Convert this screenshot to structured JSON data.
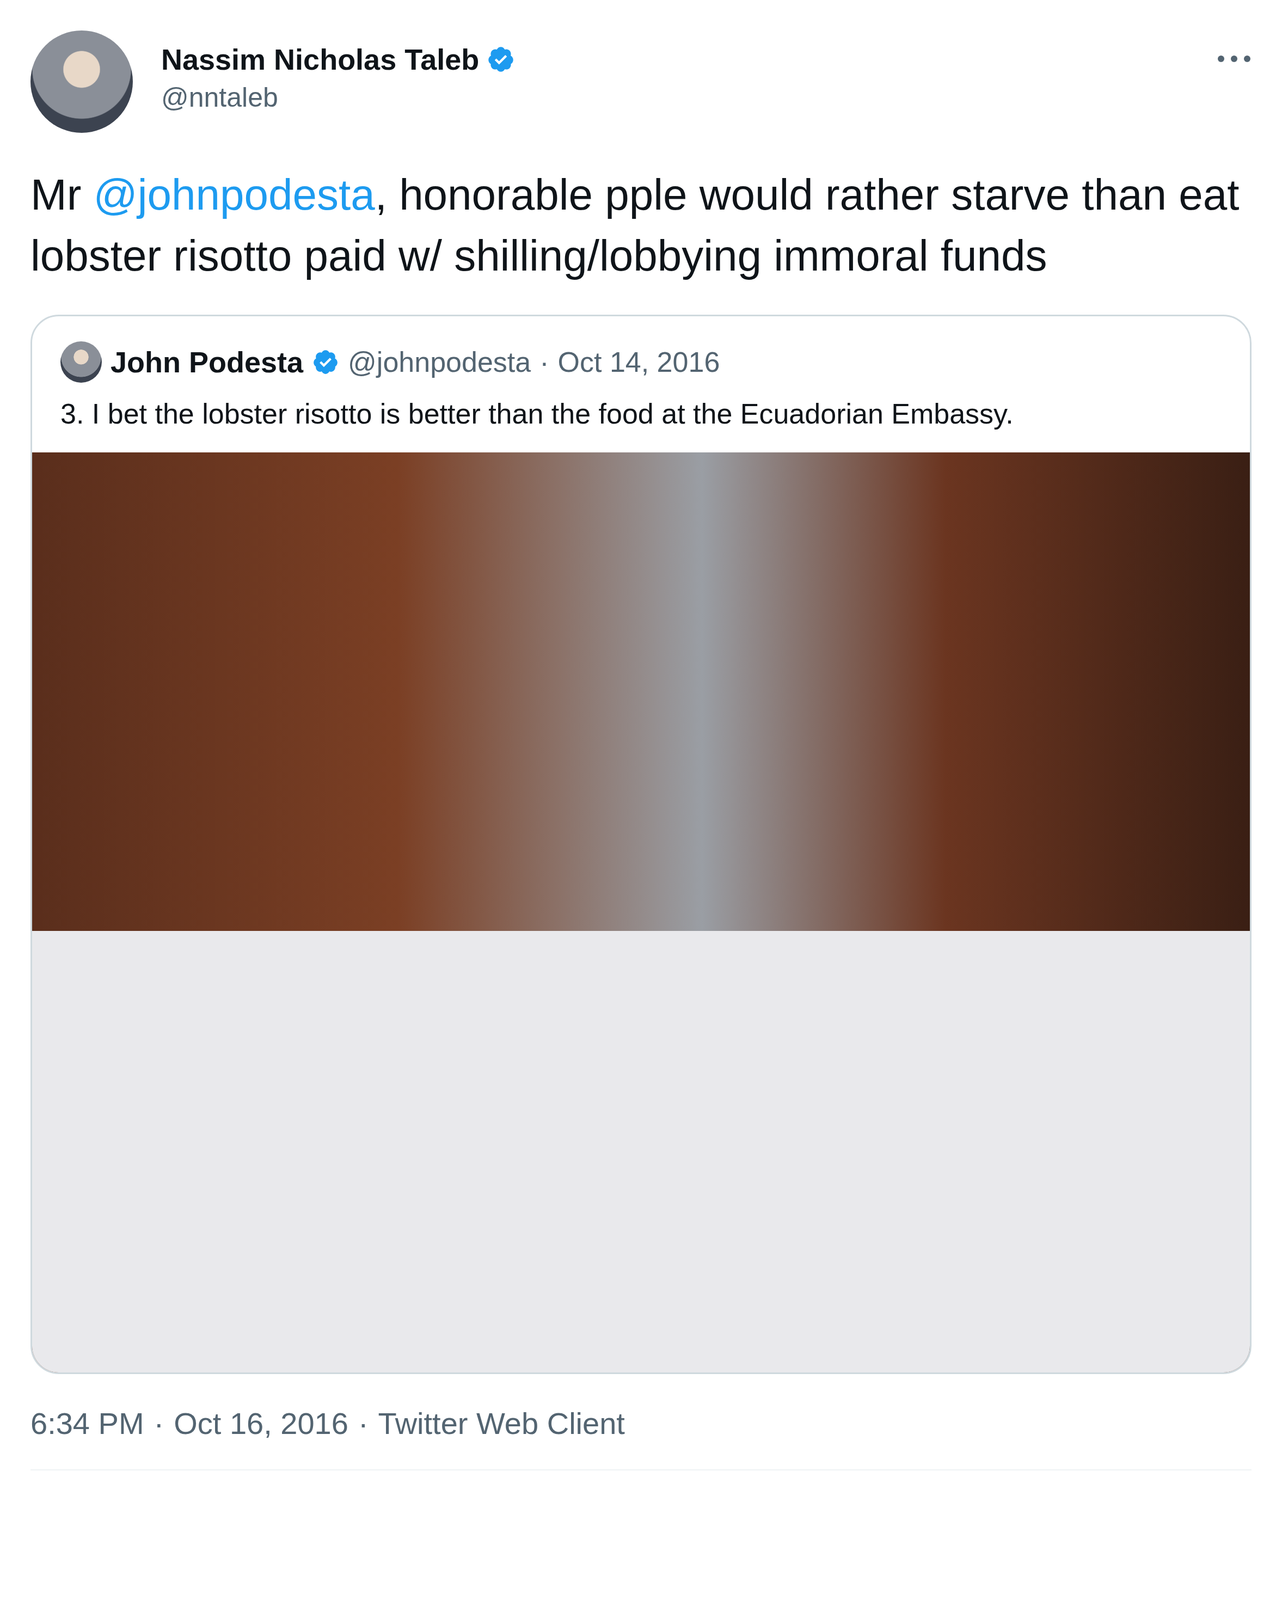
{
  "tweet": {
    "author": {
      "name": "Nassim Nicholas Taleb",
      "handle": "@nntaleb",
      "verified": true
    },
    "text": [
      {
        "text": "Mr ",
        "kind": "plain"
      },
      {
        "text": "@johnpodesta",
        "kind": "mention"
      },
      {
        "text": ", honorable pple would rather starve than eat lobster risotto paid w/ shilling/lobbying immoral funds",
        "kind": "plain"
      }
    ],
    "quote": {
      "author": {
        "name": "John Podesta",
        "handle": "@johnpodesta",
        "verified": true
      },
      "separator": "·",
      "date": "Oct 14, 2016",
      "text": "3. I bet the lobster risotto is better than the food at the Ecuadorian Embassy."
    },
    "meta": [
      "6:34 PM",
      "·",
      "Oct 16, 2016",
      "·",
      "Twitter Web Client"
    ]
  }
}
